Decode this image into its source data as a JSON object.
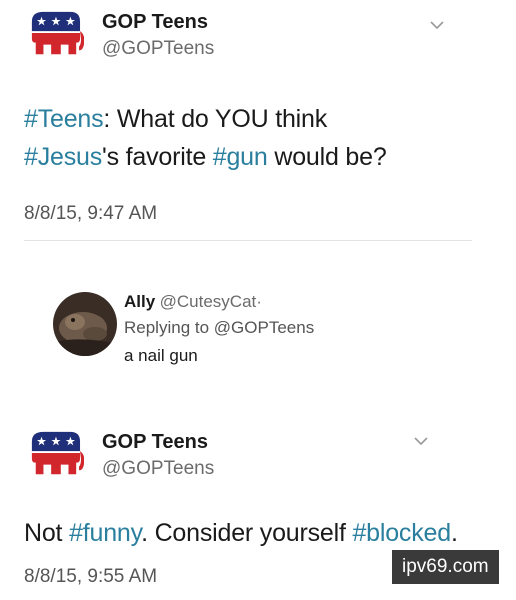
{
  "tweet1": {
    "display_name": "GOP Teens",
    "handle": "@GOPTeens",
    "avatar_icon": "gop-elephant-icon",
    "menu_icon": "chevron-down-icon",
    "text_parts": {
      "hash_teens": "#Teens",
      "t1": ": What do YOU think",
      "hash_jesus": "#Jesus",
      "t2": "'s favorite ",
      "hash_gun": "#gun",
      "t3": " would be?"
    },
    "timestamp": "8/8/15, 9:47 AM"
  },
  "reply": {
    "display_name": "Ally",
    "handle": "@CutesyCat",
    "separator": "·",
    "replying_prefix": "Replying to ",
    "replying_to": "@GOPTeens",
    "text": "a nail gun"
  },
  "tweet2": {
    "display_name": "GOP Teens",
    "handle": "@GOPTeens",
    "avatar_icon": "gop-elephant-icon",
    "menu_icon": "chevron-down-icon",
    "text_parts": {
      "t1": "Not ",
      "hash_funny": "#funny",
      "t2": ". Consider yourself ",
      "hash_blocked": "#blocked",
      "t3": "."
    },
    "timestamp": "8/8/15, 9:55 AM"
  },
  "watermark": "ipv69.com",
  "colors": {
    "hashtag": "#2a7f9e",
    "elephant_blue": "#1f2f7a",
    "elephant_red": "#d0262c"
  }
}
